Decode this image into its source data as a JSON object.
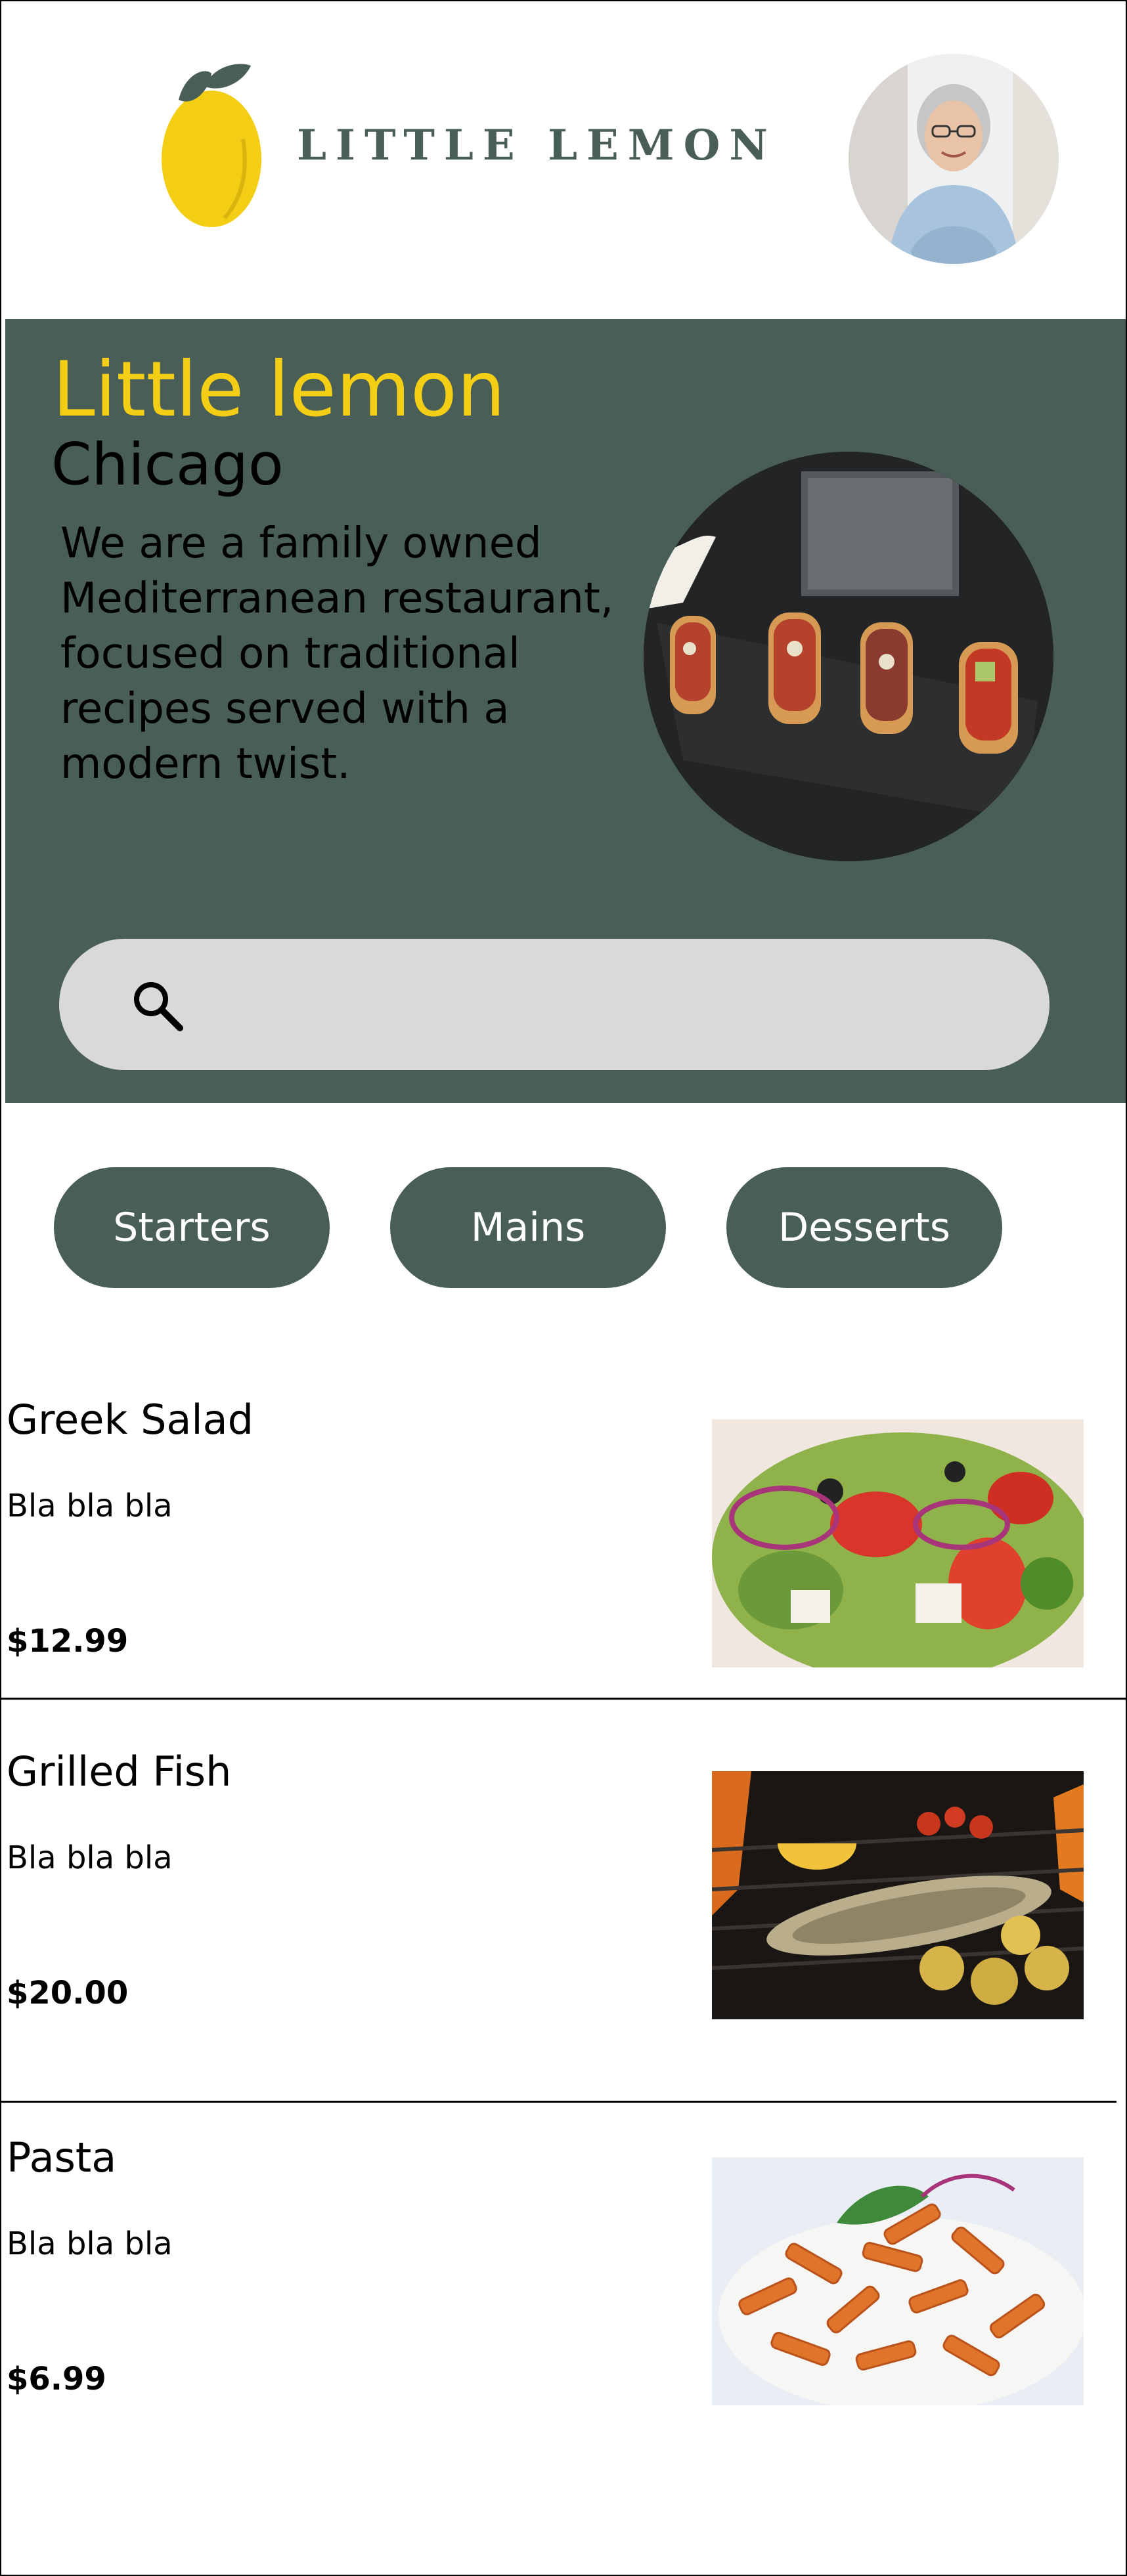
{
  "header": {
    "logo_text": "LITTLE LEMON",
    "logo_icon": "lemon-icon",
    "avatar_icon": "user-profile-photo"
  },
  "hero": {
    "title": "Little lemon",
    "subtitle": "Chicago",
    "description": "We are a family owned Mediterranean restaurant, focused on traditional recipes served with a modern twist.",
    "image_icon": "bruschetta-photo"
  },
  "search": {
    "icon": "search-icon",
    "placeholder": ""
  },
  "categories": [
    {
      "label": "Starters"
    },
    {
      "label": "Mains"
    },
    {
      "label": "Desserts"
    }
  ],
  "menu": [
    {
      "name": "Greek Salad",
      "description": "Bla bla bla",
      "price": "$12.99",
      "image_icon": "greek-salad-photo"
    },
    {
      "name": "Grilled Fish",
      "description": "Bla bla bla",
      "price": "$20.00",
      "image_icon": "grilled-fish-photo"
    },
    {
      "name": "Pasta",
      "description": "Bla bla bla",
      "price": "$6.99",
      "image_icon": "pasta-photo"
    }
  ],
  "colors": {
    "primary": "#495e57",
    "accent": "#f4ce14",
    "search_bg": "#d9d9d9",
    "background": "#ffffff"
  }
}
